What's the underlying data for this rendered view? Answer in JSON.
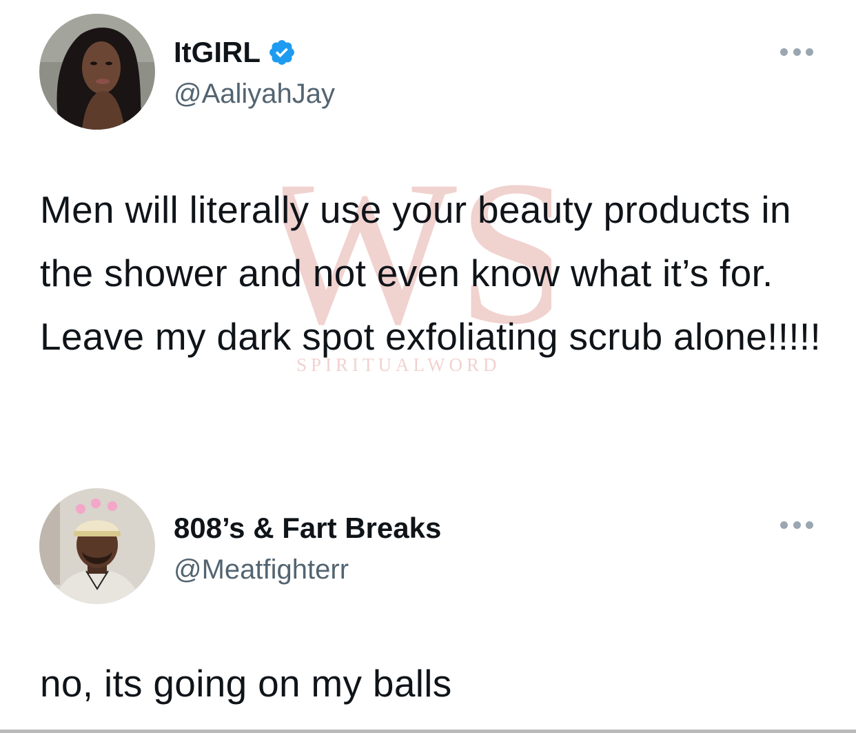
{
  "tweets": [
    {
      "display_name": "ItGIRL",
      "handle": "@AaliyahJay",
      "verified": true,
      "text": "Men will literally use your beauty products in the shower and not even know what it’s for. Leave my dark spot exfoliating scrub alone!!!!!"
    },
    {
      "display_name": "808’s & Fart Breaks",
      "handle": "@Meatfighterr",
      "verified": false,
      "text": "no, its going on my balls"
    }
  ],
  "watermark": {
    "letters": "WS",
    "text": "SPIRITUALWORD"
  },
  "icons": {
    "verified": "verified-badge-icon",
    "more": "more-options-icon"
  },
  "colors": {
    "verified_blue": "#1d9bf0",
    "handle_gray": "#536471",
    "text": "#0f1419",
    "watermark": "#c0392b"
  }
}
